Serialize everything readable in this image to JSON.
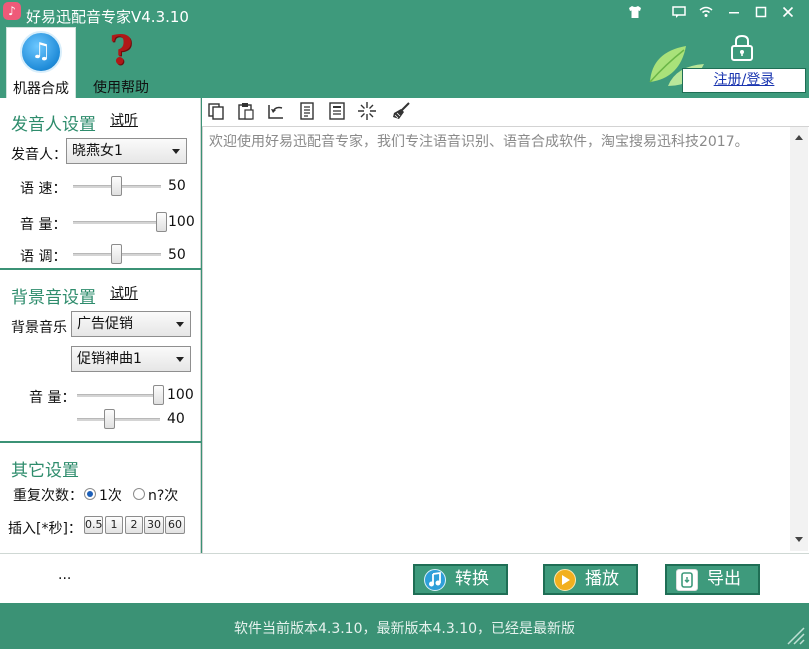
{
  "window": {
    "title": "好易迅配音专家V4.3.10",
    "app_icon": "music-note-icon",
    "controls": [
      "shirt-icon",
      "message-icon",
      "wifi-icon",
      "minimize-icon",
      "maximize-icon",
      "close-icon"
    ]
  },
  "nav": [
    {
      "label": "机器合成",
      "icon": "music-circle-icon",
      "active": true
    },
    {
      "label": "使用帮助",
      "icon": "question-mark-icon",
      "active": false
    }
  ],
  "account": {
    "login_label": "注册/登录",
    "icon": "lock-icon"
  },
  "voice_settings": {
    "title": "发音人设置",
    "listen": "试听",
    "speaker_label": "发音人：",
    "speaker_value": "晓燕女1",
    "speed_label": "语 速：",
    "speed_value": "50",
    "volume_label": "音 量：",
    "volume_value": "100",
    "pitch_label": "语 调：",
    "pitch_value": "50"
  },
  "bg_settings": {
    "title": "背景音设置",
    "listen": "试听",
    "music_label": "背景音乐",
    "category_value": "广告促销",
    "track_value": "促销神曲1",
    "volume_label": "音 量：",
    "volume_value": "100",
    "second_value": "40"
  },
  "other_settings": {
    "title": "其它设置",
    "repeat_label": "重复次数：",
    "repeat_once": "1次",
    "repeat_n": "n?次",
    "insert_label": "插入[*秒]：",
    "insert_buttons": [
      "0.5",
      "1",
      "2",
      "30",
      "60"
    ]
  },
  "toolbar": [
    "copy-icon",
    "paste-icon",
    "undo-icon",
    "document-icon",
    "list-icon",
    "sparkle-icon",
    "broom-icon"
  ],
  "editor": {
    "text": "欢迎使用好易迅配音专家，我们专注语音识别、语音合成软件，淘宝搜易迅科技2017。"
  },
  "actions": {
    "ellipsis": "...",
    "convert": "转换",
    "play": "播放",
    "export": "导出"
  },
  "status": {
    "text": "软件当前版本4.3.10，最新版本4.3.10，已经是最新版"
  },
  "colors": {
    "brand_green": "#3e9a7c",
    "section_title": "#2e8c6c",
    "link_blue": "#1a35b0"
  }
}
